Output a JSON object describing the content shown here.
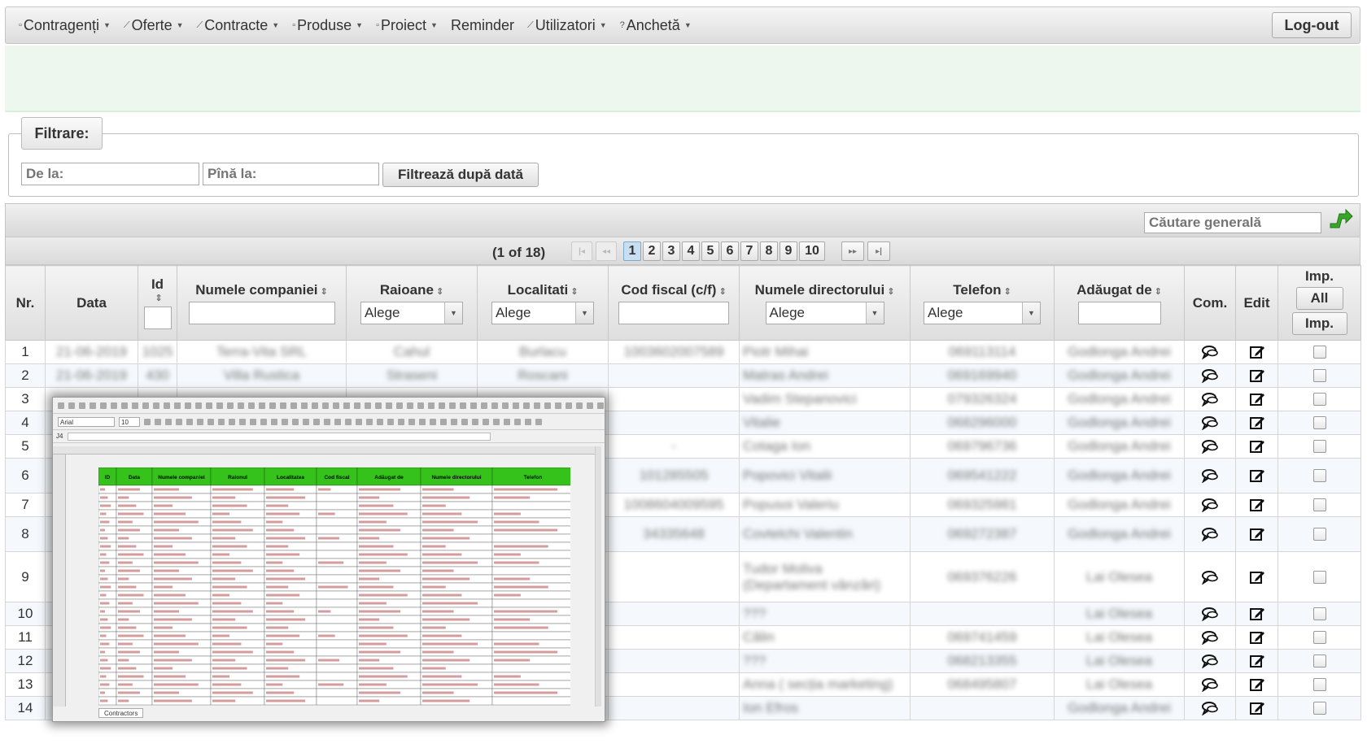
{
  "menu": {
    "items": [
      {
        "icon": "▫",
        "label": "Contragenți",
        "caret": true
      },
      {
        "icon": "⟋",
        "label": "Oferte",
        "caret": true
      },
      {
        "icon": "⟋",
        "label": "Contracte",
        "caret": true
      },
      {
        "icon": "▫",
        "label": "Produse",
        "caret": true
      },
      {
        "icon": "▫",
        "label": "Proiect",
        "caret": true
      },
      {
        "icon": "",
        "label": "Reminder",
        "caret": false
      },
      {
        "icon": "⟋",
        "label": "Utilizatori",
        "caret": true
      },
      {
        "icon": "?",
        "label": "Anchetă",
        "caret": true
      }
    ],
    "logout": "Log-out"
  },
  "filter": {
    "legend": "Filtrare:",
    "from_placeholder": "De la:",
    "to_placeholder": "Pînă la:",
    "button": "Filtrează după dată"
  },
  "search": {
    "placeholder": "Căutare generală",
    "export_icon": "excel-export-icon"
  },
  "pagination": {
    "report": "(1 of 18)",
    "pages": [
      "1",
      "2",
      "3",
      "4",
      "5",
      "6",
      "7",
      "8",
      "9",
      "10"
    ],
    "current": "1"
  },
  "table": {
    "headers": {
      "nr": "Nr.",
      "data": "Data",
      "id": "Id",
      "company": "Numele companiei",
      "raion": "Raioane",
      "localitati": "Localitati",
      "cod_fiscal": "Cod fiscal (c/f)",
      "director": "Numele directorului",
      "telefon": "Telefon",
      "adaugat": "Adăugat de",
      "com": "Com.",
      "edit": "Edit",
      "imp": "Imp.",
      "imp_all_button": "All",
      "imp_button": "Imp."
    },
    "select_default": "Alege",
    "rows": [
      {
        "nr": "1",
        "date": "21-06-2019",
        "id": "1025",
        "company": "Terra-Vita SRL",
        "raion": "Cahul",
        "loc": "Burlacu",
        "cf": "1003602007589",
        "director": "Piotr Mihai",
        "tel": "069113114",
        "added": "Godlonga Andrei",
        "h": 29
      },
      {
        "nr": "2",
        "date": "21-06-2019",
        "id": "430",
        "company": "Villa Rustica",
        "raion": "Straseni",
        "loc": "Roscani",
        "cf": "",
        "director": "Matras Andrei",
        "tel": "069169940",
        "added": "Godlonga Andrei",
        "h": 29
      },
      {
        "nr": "3",
        "date": "",
        "id": "",
        "company": "",
        "raion": "",
        "loc": "",
        "cf": "",
        "director": "Vadim Stepanovici",
        "tel": "079326324",
        "added": "Godlonga Andrei",
        "h": 29
      },
      {
        "nr": "4",
        "date": "",
        "id": "",
        "company": "",
        "raion": "",
        "loc": "",
        "cf": "",
        "director": "Vitalie",
        "tel": "068296000",
        "added": "Godlonga Andrei",
        "h": 29
      },
      {
        "nr": "5",
        "date": "",
        "id": "",
        "company": "",
        "raion": "",
        "loc": "",
        "cf": "-",
        "director": "Cotaga Ion",
        "tel": "069796736",
        "added": "Godlonga Andrei",
        "h": 29
      },
      {
        "nr": "6",
        "date": "",
        "id": "",
        "company": "",
        "raion": "",
        "loc": "",
        "cf": "101285505",
        "director": "Popovici Vitalii",
        "tel": "069541222",
        "added": "Godlonga Andrei",
        "h": 43
      },
      {
        "nr": "7",
        "date": "",
        "id": "",
        "company": "",
        "raion": "",
        "loc": "",
        "cf": "1008604009595",
        "director": "Popusoi Valeriu",
        "tel": "069325981",
        "added": "Godlonga Andrei",
        "h": 29
      },
      {
        "nr": "8",
        "date": "",
        "id": "",
        "company": "",
        "raion": "",
        "loc": "",
        "cf": "34335648",
        "director": "Covtelchi Valentin",
        "tel": "069272387",
        "added": "Godlonga Andrei",
        "h": 43
      },
      {
        "nr": "9",
        "date": "",
        "id": "",
        "company": "",
        "raion": "",
        "loc": "",
        "cf": "",
        "director": "Tudor Moliva (Departament vânzări)",
        "tel": "069376226",
        "added": "Lai Olesea",
        "h": 62
      },
      {
        "nr": "10",
        "date": "",
        "id": "",
        "company": "",
        "raion": "",
        "loc": "",
        "cf": "",
        "director": "???",
        "tel": "",
        "added": "Lai Olesea",
        "h": 29
      },
      {
        "nr": "11",
        "date": "",
        "id": "",
        "company": "",
        "raion": "",
        "loc": "",
        "cf": "",
        "director": "Călin",
        "tel": "069741459",
        "added": "Lai Olesea",
        "h": 29
      },
      {
        "nr": "12",
        "date": "",
        "id": "",
        "company": "",
        "raion": "",
        "loc": "",
        "cf": "",
        "director": "???",
        "tel": "068213355",
        "added": "Lai Olesea",
        "h": 29
      },
      {
        "nr": "13",
        "date": "",
        "id": "",
        "company": "",
        "raion": "",
        "loc": "",
        "cf": "",
        "director": "Anna ( secția marketing)",
        "tel": "068495807",
        "added": "Lai Olesea",
        "h": 29
      },
      {
        "nr": "14",
        "date": "",
        "id": "",
        "company": "",
        "raion": "",
        "loc": "",
        "cf": "",
        "director": "Ion Efros",
        "tel": "",
        "added": "Godlonga Andrei",
        "h": 29
      }
    ]
  },
  "spreadsheet": {
    "font": "Arial",
    "size": "10",
    "cell_ref": "J4",
    "headers": [
      "ID",
      "Data",
      "Numele companiei",
      "Raionul",
      "Localitatea",
      "Cod fiscal",
      "Adăugat de",
      "Numele directorului",
      "Telefon"
    ],
    "sheet_tab": "Contractors",
    "header_color": "#35c21a"
  }
}
